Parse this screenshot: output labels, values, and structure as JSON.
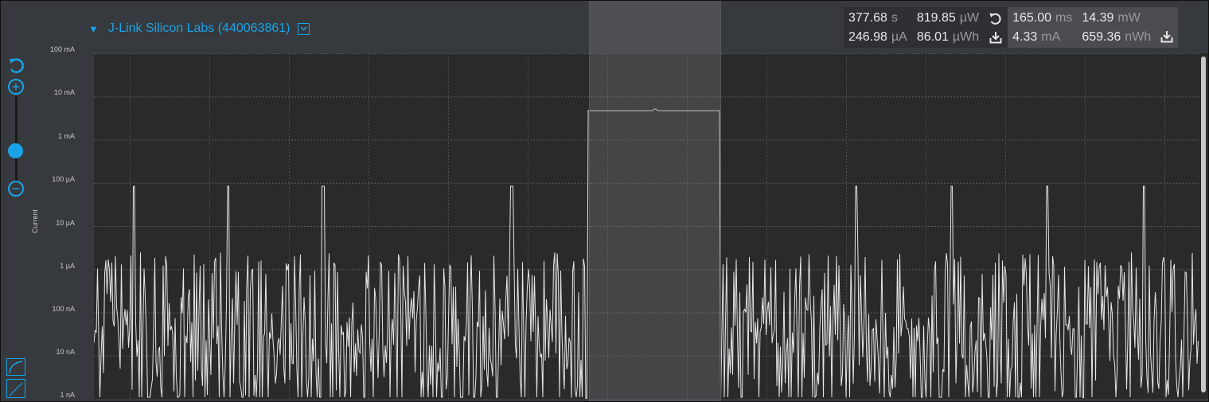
{
  "device": {
    "name": "J-Link Silicon Labs (440063861)",
    "expand_icon": "triangle-down-icon",
    "dropdown_icon": "chevron-down-icon"
  },
  "stats": {
    "total": {
      "time": {
        "value": "377.68",
        "unit": "s"
      },
      "current": {
        "value": "246.98",
        "unit": "µA"
      },
      "power": {
        "value": "819.85",
        "unit": "µW"
      },
      "energy": {
        "value": "86.01",
        "unit": "µWh"
      }
    },
    "selection": {
      "time": {
        "value": "165.00",
        "unit": "ms"
      },
      "current": {
        "value": "4.33",
        "unit": "mA"
      },
      "power": {
        "value": "14.39",
        "unit": "mW"
      },
      "energy": {
        "value": "659.36",
        "unit": "nWh"
      }
    }
  },
  "axis": {
    "title": "Current",
    "labels": [
      "100 mA",
      "10 mA",
      "1 mA",
      "100 µA",
      "10 µA",
      "1 µA",
      "100 nA",
      "10 nA",
      "1 nA"
    ]
  },
  "colors": {
    "accent": "#1aa3e8",
    "trace": "#e6e6e6",
    "plot_bg": "#2a2a2b",
    "chrome_bg": "#363a3e"
  }
}
